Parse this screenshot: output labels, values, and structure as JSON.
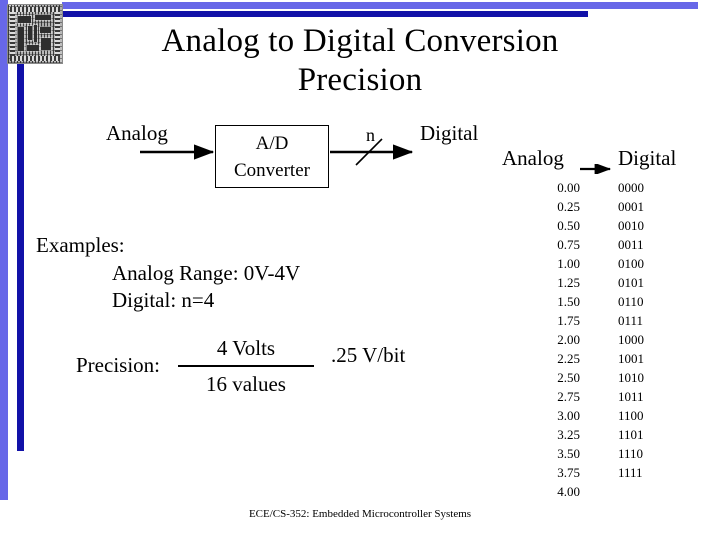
{
  "slide": {
    "title": "Analog to Digital Conversion Precision",
    "title_line1": "Analog to Digital Conversion",
    "title_line2": "Precision",
    "footer": "ECE/CS-352: Embedded Microcontroller Systems",
    "logo_alt": "circuit-board-chip"
  },
  "colors": {
    "accent_light": "#6767e8",
    "accent_dark": "#1111a8",
    "background": "#ffffff",
    "text": "#000000"
  },
  "diagram": {
    "input_label": "Analog",
    "block_line1": "A/D",
    "block_line2": "Converter",
    "bus_width_label": "n",
    "output_label": "Digital"
  },
  "examples": {
    "heading": "Examples:",
    "line1": "Analog Range: 0V-4V",
    "line2": "Digital: n=4"
  },
  "precision": {
    "label": "Precision:",
    "numerator": "4 Volts",
    "denominator": "16 values",
    "result": ".25 V/bit"
  },
  "table": {
    "header_analog": "Analog",
    "header_digital": "Digital",
    "rows": [
      {
        "analog": "0.00",
        "digital": "0000"
      },
      {
        "analog": "0.25",
        "digital": "0001"
      },
      {
        "analog": "0.50",
        "digital": "0010"
      },
      {
        "analog": "0.75",
        "digital": "0011"
      },
      {
        "analog": "1.00",
        "digital": "0100"
      },
      {
        "analog": "1.25",
        "digital": "0101"
      },
      {
        "analog": "1.50",
        "digital": "0110"
      },
      {
        "analog": "1.75",
        "digital": "0111"
      },
      {
        "analog": "2.00",
        "digital": "1000"
      },
      {
        "analog": "2.25",
        "digital": "1001"
      },
      {
        "analog": "2.50",
        "digital": "1010"
      },
      {
        "analog": "2.75",
        "digital": "1011"
      },
      {
        "analog": "3.00",
        "digital": "1100"
      },
      {
        "analog": "3.25",
        "digital": "1101"
      },
      {
        "analog": "3.50",
        "digital": "1110"
      },
      {
        "analog": "3.75",
        "digital": "1111"
      },
      {
        "analog": "4.00",
        "digital": ""
      }
    ]
  }
}
